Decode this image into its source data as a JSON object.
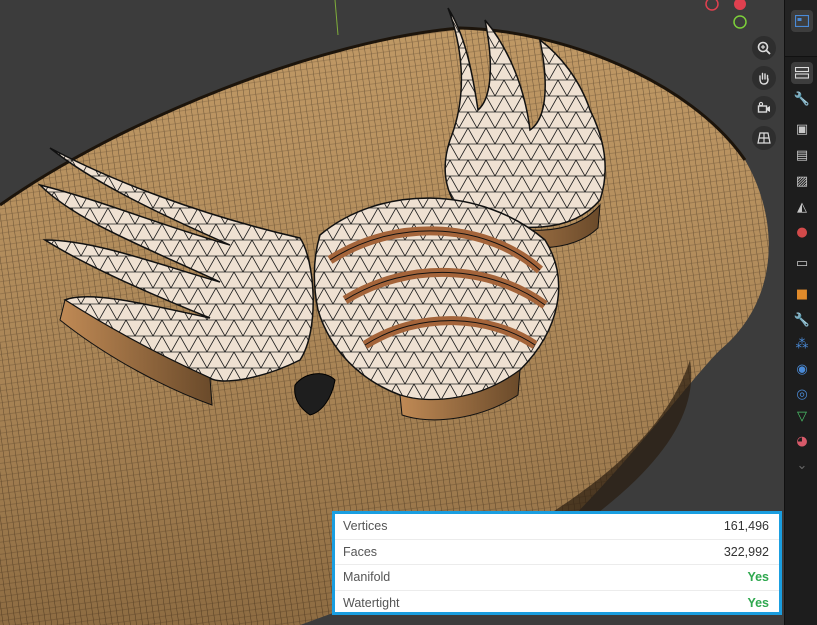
{
  "viewport": {
    "navigation": {
      "zoom_icon": "zoom-in-icon",
      "pan_icon": "hand-pan-icon",
      "camera_icon": "camera-view-icon",
      "ortho_icon": "grid-perspective-icon"
    },
    "gizmo_colors": {
      "x": "#e0404f",
      "y": "#7ccf3a",
      "z": "#3a8cf0"
    }
  },
  "properties_tabs": [
    {
      "name": "tool-tab",
      "icon": "tool-icon",
      "color": "#c8c8c8"
    },
    {
      "name": "render-tab",
      "icon": "render-camera-icon",
      "color": "#c8c8c8"
    },
    {
      "name": "output-tab",
      "icon": "printer-icon",
      "color": "#c8c8c8"
    },
    {
      "name": "view-layer-tab",
      "icon": "image-icon",
      "color": "#c8c8c8"
    },
    {
      "name": "scene-tab",
      "icon": "scene-icon",
      "color": "#c8c8c8"
    },
    {
      "name": "world-tab",
      "icon": "world-icon",
      "color": "#d24a4a"
    },
    {
      "name": "collection-tab",
      "icon": "box-icon",
      "color": "#c8c8c8"
    },
    {
      "name": "object-tab",
      "icon": "object-icon",
      "color": "#e08a2a"
    },
    {
      "name": "modifiers-tab",
      "icon": "wrench-icon",
      "color": "#4a8ad6"
    },
    {
      "name": "particles-tab",
      "icon": "particles-icon",
      "color": "#4a8ad6"
    },
    {
      "name": "physics-tab",
      "icon": "physics-icon",
      "color": "#4a8ad6"
    },
    {
      "name": "constraints-tab",
      "icon": "constraints-icon",
      "color": "#4a8ad6"
    },
    {
      "name": "data-tab",
      "icon": "mesh-data-icon",
      "color": "#4cc46a"
    },
    {
      "name": "material-tab",
      "icon": "material-icon",
      "color": "#d85a6a"
    }
  ],
  "stats": {
    "vertices_label": "Vertices",
    "vertices_value": "161,496",
    "faces_label": "Faces",
    "faces_value": "322,992",
    "manifold_label": "Manifold",
    "manifold_value": "Yes",
    "watertight_label": "Watertight",
    "watertight_value": "Yes",
    "accent_color": "#1a9ee0",
    "ok_color": "#2fa84f"
  }
}
